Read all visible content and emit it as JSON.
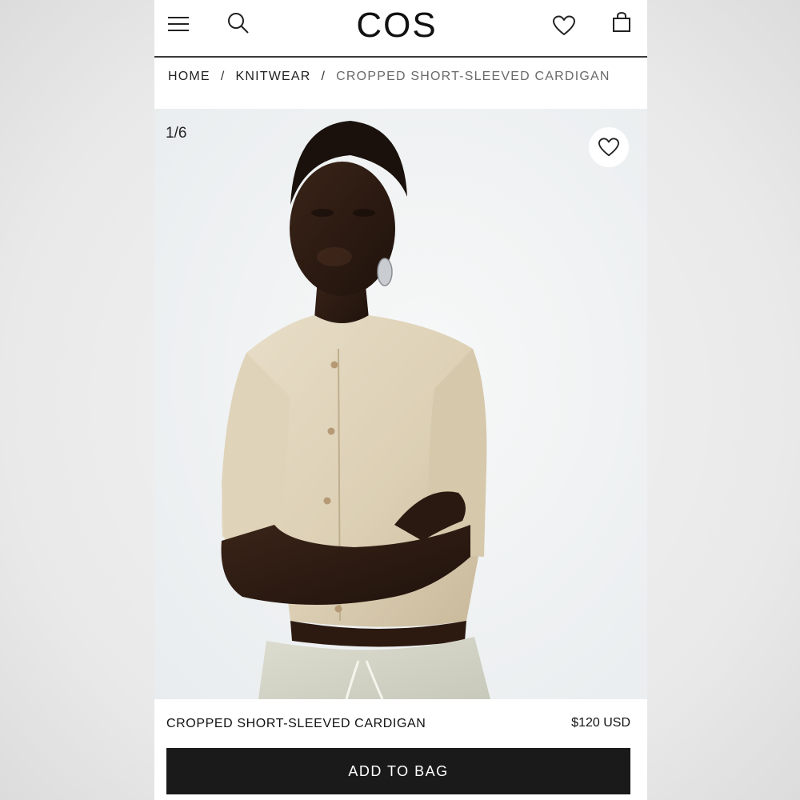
{
  "header": {
    "logo": "COS",
    "icons": {
      "menu": "hamburger-icon",
      "search": "search-icon",
      "wishlist": "heart-icon",
      "bag": "bag-icon"
    }
  },
  "breadcrumb": {
    "items": [
      "HOME",
      "KNITWEAR",
      "CROPPED SHORT-SLEEVED CARDIGAN"
    ],
    "separator": "/"
  },
  "gallery": {
    "counter": "1/6",
    "favorite_icon": "heart-icon"
  },
  "product": {
    "name": "CROPPED SHORT-SLEEVED CARDIGAN",
    "price": "$120 USD",
    "add_to_bag_label": "ADD TO BAG"
  },
  "colors": {
    "button": "#1a1a1a",
    "cardigan": "#e2d6bd",
    "background": "#eef1f3"
  }
}
